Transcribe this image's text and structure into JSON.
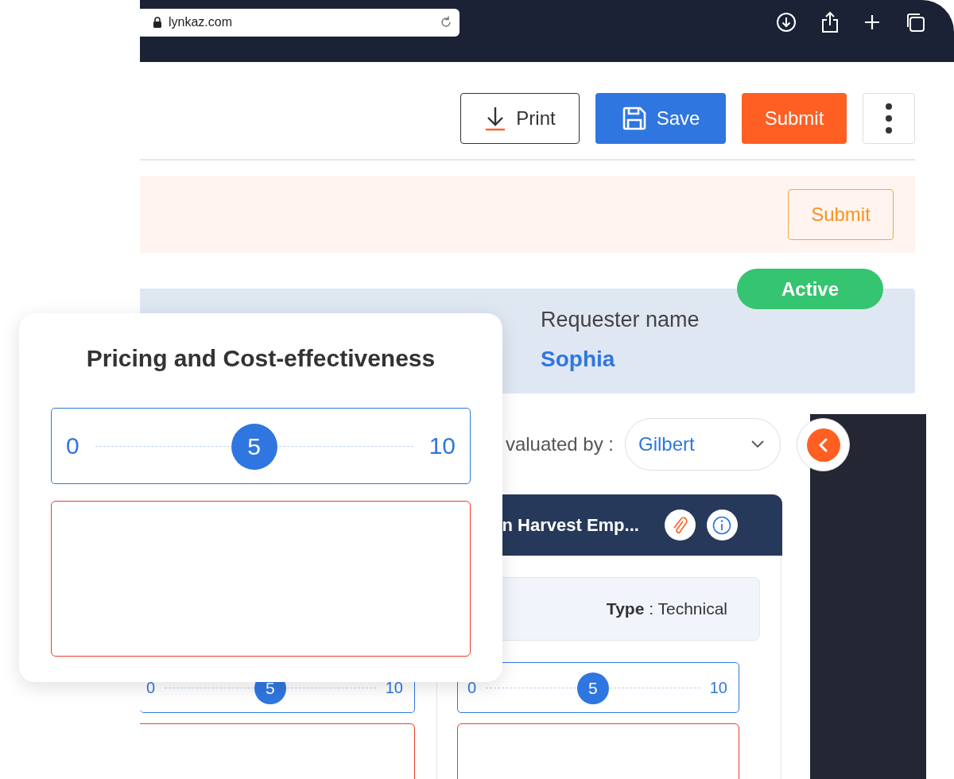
{
  "browser": {
    "url": "lynkaz.com"
  },
  "toolbar": {
    "buttons": [
      {
        "kind": "print",
        "label": "Print"
      },
      {
        "kind": "save",
        "label": "Save"
      },
      {
        "kind": "submit",
        "label": "Submit"
      },
      {
        "kind": "more"
      }
    ]
  },
  "banner": {
    "button": "Submit"
  },
  "info": {
    "status": "Active",
    "requester_label": "Requester name",
    "requester_name": "Sophia"
  },
  "evaluation": {
    "label": "valuated by :",
    "evaluator": "Gilbert"
  },
  "supplier_card": {
    "title": "n Harvest Emp...",
    "type_text": "**Type** : Technical"
  },
  "score_sliders": [
    {
      "min": "0",
      "value": "5",
      "max": "10",
      "level": 0.5
    },
    {
      "min": "0",
      "value": "5",
      "max": "10",
      "level": 0.5
    }
  ],
  "popup": {
    "title": "Pricing and Cost-effectiveness",
    "slider": {
      "min": "0",
      "value": "5",
      "max": "10",
      "level": 0.5
    }
  }
}
